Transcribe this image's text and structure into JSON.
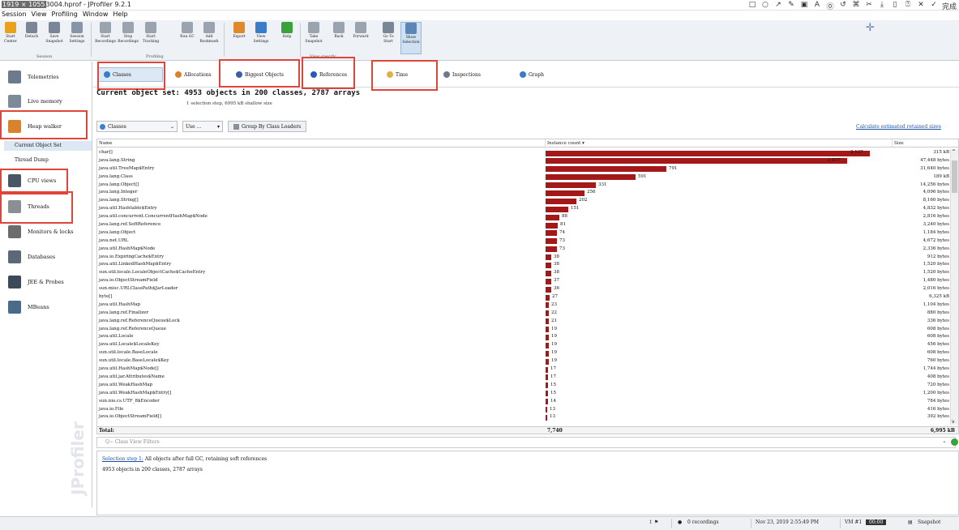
{
  "titlebar": {
    "highlight": "1919 × 1055",
    "rest": "3004.hprof - JProfiler 9.2.1"
  },
  "screenshot_tools": [
    "□",
    "○",
    "↗",
    "✎",
    "▣",
    "A",
    "⓪",
    "↺",
    "⌘",
    "✂",
    "⤓",
    "▯",
    "⍰",
    "✕",
    "✓"
  ],
  "screenshot_tools_done": "完成",
  "menu": [
    "Session",
    "View",
    "Profiling",
    "Window",
    "Help"
  ],
  "toolbar": {
    "buttons": [
      {
        "label": "Start Center",
        "color": "#e8a21b"
      },
      {
        "label": "Detach",
        "color": "#7a8696"
      },
      {
        "label": "Save Snapshot",
        "color": "#7a8696"
      },
      {
        "label": "Session Settings",
        "color": "#8795a8"
      },
      {
        "label": "Start Recordings",
        "color": "#9aa3ae"
      },
      {
        "label": "Stop Recordings",
        "color": "#9aa3ae"
      },
      {
        "label": "Start Tracking",
        "color": "#9aa3ae"
      },
      {
        "label": "Run GC",
        "color": "#9aa3ae"
      },
      {
        "label": "Add Bookmark",
        "color": "#9aa3ae"
      },
      {
        "label": "Export",
        "color": "#e0892a"
      },
      {
        "label": "View Settings",
        "color": "#3a7cc8"
      },
      {
        "label": "Help",
        "color": "#3aa23a"
      },
      {
        "label": "Take Snapshot",
        "color": "#9aa3ae"
      },
      {
        "label": "Back",
        "color": "#9aa3ae"
      },
      {
        "label": "Forward",
        "color": "#9aa3ae"
      },
      {
        "label": "Go To Start",
        "color": "#7a8696"
      },
      {
        "label": "Show Selection",
        "color": "#5c86b8"
      }
    ],
    "groups": [
      "Session",
      "Profiling",
      "View specific"
    ]
  },
  "sidebar": {
    "items": [
      {
        "label": "Telemetries",
        "color": "#6b7a8c"
      },
      {
        "label": "Live memory",
        "color": "#7d8a9a"
      },
      {
        "label": "Heap walker",
        "color": "#d9822b"
      },
      {
        "label": "CPU views",
        "color": "#4a5666"
      },
      {
        "label": "Threads",
        "color": "#8a8f96"
      },
      {
        "label": "Monitors & locks",
        "color": "#6c6c6c"
      },
      {
        "label": "Databases",
        "color": "#5a6878"
      },
      {
        "label": "JEE & Probes",
        "color": "#3d4a5a"
      },
      {
        "label": "MBeans",
        "color": "#4a6a8a"
      }
    ],
    "subitems": [
      "Current Object Set",
      "Thread Dump"
    ],
    "watermark": "JProfiler"
  },
  "viewtabs": [
    {
      "label": "Classes",
      "color": "#3a7cc8"
    },
    {
      "label": "Allocations",
      "color": "#d9822b"
    },
    {
      "label": "Biggest Objects",
      "color": "#3a5fa8"
    },
    {
      "label": "References",
      "color": "#2a5ab8"
    },
    {
      "label": "Time",
      "color": "#e0b040"
    },
    {
      "label": "Inspections",
      "color": "#6a7a8a"
    },
    {
      "label": "Graph",
      "color": "#3a7cc8"
    }
  ],
  "summary": {
    "title": "Current object set: 4953 objects in 200 classes, 2787 arrays",
    "sub": "1 selection step, 6995 kB shallow size"
  },
  "controls": {
    "classes_dropdown": "Classes",
    "use_dropdown": "Use ...",
    "group_button": "Group By Class Loaders",
    "calc_link": "Calculate estimated retained sizes"
  },
  "table": {
    "columns": [
      "Name",
      "Instance count ▾",
      "Size"
    ],
    "max_count": 2127,
    "rows": [
      {
        "name": "char[]",
        "count": 2127,
        "count_label": "2,127",
        "size": "315 kB"
      },
      {
        "name": "java.lang.String",
        "count": 1977,
        "count_label": "1,977",
        "size": "47,448 bytes"
      },
      {
        "name": "java.util.TreeMap$Entry",
        "count": 791,
        "count_label": "791",
        "size": "31,640 bytes"
      },
      {
        "name": "java.lang.Class",
        "count": 591,
        "count_label": "591",
        "size": "189 kB"
      },
      {
        "name": "java.lang.Object[]",
        "count": 331,
        "count_label": "331",
        "size": "14,256 bytes"
      },
      {
        "name": "java.lang.Integer",
        "count": 256,
        "count_label": "256",
        "size": "4,096 bytes"
      },
      {
        "name": "java.lang.String[]",
        "count": 202,
        "count_label": "202",
        "size": "8,160 bytes"
      },
      {
        "name": "java.util.Hashtable$Entry",
        "count": 151,
        "count_label": "151",
        "size": "4,832 bytes"
      },
      {
        "name": "java.util.concurrent.ConcurrentHashMap$Node",
        "count": 88,
        "count_label": "88",
        "size": "2,816 bytes"
      },
      {
        "name": "java.lang.ref.SoftReference",
        "count": 81,
        "count_label": "81",
        "size": "3,240 bytes"
      },
      {
        "name": "java.lang.Object",
        "count": 74,
        "count_label": "74",
        "size": "1,184 bytes"
      },
      {
        "name": "java.net.URL",
        "count": 73,
        "count_label": "73",
        "size": "4,672 bytes"
      },
      {
        "name": "java.util.HashMap$Node",
        "count": 73,
        "count_label": "73",
        "size": "2,336 bytes"
      },
      {
        "name": "java.io.ExpiringCache$Entry",
        "count": 38,
        "count_label": "38",
        "size": "912 bytes"
      },
      {
        "name": "java.util.LinkedHashMap$Entry",
        "count": 38,
        "count_label": "38",
        "size": "1,520 bytes"
      },
      {
        "name": "sun.util.locale.LocaleObjectCache$CacheEntry",
        "count": 38,
        "count_label": "38",
        "size": "1,520 bytes"
      },
      {
        "name": "java.io.ObjectStreamField",
        "count": 37,
        "count_label": "37",
        "size": "1,480 bytes"
      },
      {
        "name": "sun.misc.URLClassPath$JarLoader",
        "count": 36,
        "count_label": "36",
        "size": "2,016 bytes"
      },
      {
        "name": "byte[]",
        "count": 27,
        "count_label": "27",
        "size": "6,325 kB"
      },
      {
        "name": "java.util.HashMap",
        "count": 23,
        "count_label": "23",
        "size": "1,104 bytes"
      },
      {
        "name": "java.lang.ref.Finalizer",
        "count": 22,
        "count_label": "22",
        "size": "880 bytes"
      },
      {
        "name": "java.lang.ref.ReferenceQueue$Lock",
        "count": 21,
        "count_label": "21",
        "size": "336 bytes"
      },
      {
        "name": "java.lang.ref.ReferenceQueue",
        "count": 19,
        "count_label": "19",
        "size": "608 bytes"
      },
      {
        "name": "java.util.Locale",
        "count": 19,
        "count_label": "19",
        "size": "608 bytes"
      },
      {
        "name": "java.util.Locale$LocaleKey",
        "count": 19,
        "count_label": "19",
        "size": "456 bytes"
      },
      {
        "name": "sun.util.locale.BaseLocale",
        "count": 19,
        "count_label": "19",
        "size": "608 bytes"
      },
      {
        "name": "sun.util.locale.BaseLocale$Key",
        "count": 19,
        "count_label": "19",
        "size": "760 bytes"
      },
      {
        "name": "java.util.HashMap$Node[]",
        "count": 17,
        "count_label": "17",
        "size": "1,744 bytes"
      },
      {
        "name": "java.util.jar.Attributes$Name",
        "count": 17,
        "count_label": "17",
        "size": "408 bytes"
      },
      {
        "name": "java.util.WeakHashMap",
        "count": 15,
        "count_label": "15",
        "size": "720 bytes"
      },
      {
        "name": "java.util.WeakHashMap$Entry[]",
        "count": 15,
        "count_label": "15",
        "size": "1,200 bytes"
      },
      {
        "name": "sun.nio.cs.UTF_8$Encoder",
        "count": 14,
        "count_label": "14",
        "size": "784 bytes"
      },
      {
        "name": "java.io.File",
        "count": 13,
        "count_label": "13",
        "size": "416 bytes"
      },
      {
        "name": "java.io.ObjectStreamField[]",
        "count": 13,
        "count_label": "13",
        "size": "392 bytes"
      }
    ],
    "total_label": "Total:",
    "total_count": "7,740",
    "total_size": "6,995 kB"
  },
  "filter": {
    "placeholder": "Q~ Class View Filters"
  },
  "console": {
    "link": "Selection step 1:",
    "line1": " All objects after full GC, retaining soft references",
    "line2": "4953 objects in 200 classes, 2787 arrays"
  },
  "statusbar": {
    "recordings": "0 recordings",
    "datetime": "Nov 23, 2019 2:55:49 PM",
    "vm": "VM #1",
    "elapsed": "00:00",
    "snapshot": "Snapshot"
  }
}
